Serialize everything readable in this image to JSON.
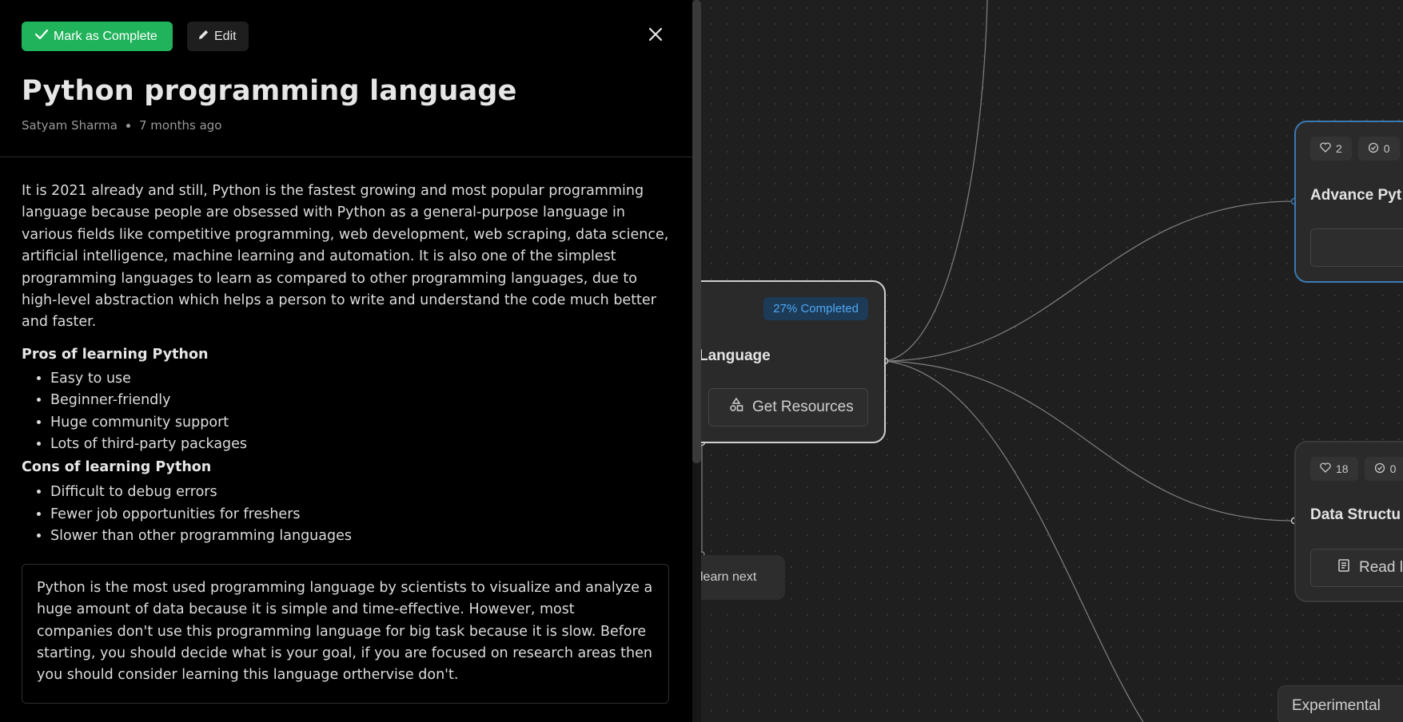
{
  "panel": {
    "actions": {
      "mark_complete": "Mark as Complete",
      "edit": "Edit"
    },
    "title": "Python programming language",
    "author": "Satyam Sharma",
    "time_ago": "7 months ago",
    "intro": "It is 2021 already and still, Python is the fastest growing and most popular programming language because people are obsessed with Python as a general-purpose language in various fields like competitive programming, web development, web scraping, data science, artificial intelligence, machine learning and automation. It is also one of the simplest programming languages to learn as compared to other programming languages, due to high-level abstraction which helps a person to write and understand the code much better and faster.",
    "pros": {
      "heading": "Pros of learning Python",
      "items": [
        "Easy to use",
        "Beginner-friendly",
        "Huge community support",
        "Lots of third-party packages"
      ]
    },
    "cons": {
      "heading": "Cons of learning Python",
      "items": [
        "Difficult to debug errors",
        "Fewer job opportunities for freshers",
        "Slower than other programming languages"
      ]
    },
    "quote": "Python is the most used programming language by scientists to visualize and analyze a huge amount of data because it is simple and time-effective. However, most companies don't use this programming language for big task because it is slow. Before starting, you should decide what is your goal, if you are focused on research areas then you should consider learning this language orthervise don't."
  },
  "canvas": {
    "main_node": {
      "badge": "27% Completed",
      "title": "Language",
      "resource_button": "Get Resources"
    },
    "advance_node": {
      "likes": "2",
      "completions": "0",
      "title": "Advance Pyt"
    },
    "ds_node": {
      "likes": "18",
      "completions": "0",
      "title": "Data Structu",
      "resource_button": "Read l"
    },
    "learn_next": "learn next",
    "experimental": "Experimental"
  },
  "colors": {
    "accent_green": "#21b35b",
    "badge_blue": "#4ea8f2",
    "selected_border": "#3b79b3",
    "panel_bg": "#000000",
    "canvas_bg": "#1f1f1f"
  }
}
